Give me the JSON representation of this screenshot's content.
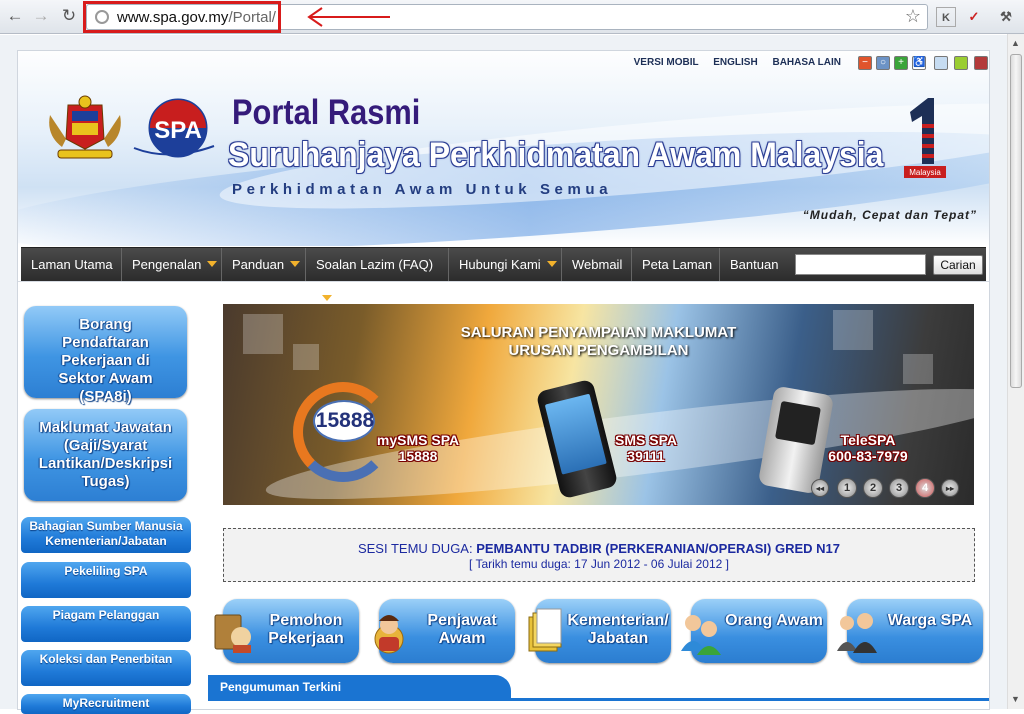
{
  "browser": {
    "url_domain": "www.spa.gov.my",
    "url_path": "/Portal/",
    "back_icon": "back-arrow-icon",
    "forward_icon": "forward-arrow-icon",
    "reload_icon": "reload-icon",
    "bookmark_icon": "star-icon",
    "annotation_color": "#d81b1b"
  },
  "toplinks": {
    "mobile": "VERSI MOBIL",
    "english": "ENGLISH",
    "other": "BAHASA LAIN"
  },
  "header": {
    "title1": "Portal Rasmi",
    "title2": "Suruhanjaya Perkhidmatan Awam Malaysia",
    "subtitle": "Perkhidmatan Awam Untuk Semua",
    "tagline": "“Mudah, Cepat dan Tepat”",
    "logo_spa": "SPA",
    "logo_one_label": "Malaysia"
  },
  "nav": {
    "items": [
      "Laman Utama",
      "Pengenalan",
      "Panduan",
      "Soalan Lazim (FAQ)",
      "Hubungi Kami",
      "Webmail",
      "Peta Laman",
      "Bantuan"
    ],
    "search_button": "Carian",
    "accent": "#f2b22c"
  },
  "sidebar": {
    "big_buttons": [
      "Borang Pendaftaran Pekerjaan di Sektor Awam (SPA8i)",
      "Maklumat Jawatan (Gaji/Syarat Lantikan/Deskripsi Tugas)"
    ],
    "links": [
      "Bahagian Sumber Manusia Kementerian/Jabatan",
      "Pekeliling SPA",
      "Piagam Pelanggan",
      "Koleksi dan Penerbitan",
      "MyRecruitment"
    ]
  },
  "banner": {
    "line1": "SALURAN PENYAMPAIAN MAKLUMAT",
    "line2": "URUSAN PENGAMBILAN",
    "ring_number": "15888",
    "ch1_name": "mySMS SPA",
    "ch1_num": "15888",
    "ch2_name": "SMS SPA",
    "ch2_num": "39111",
    "ch3_name": "TeleSPA",
    "ch3_num": "600-83-7979",
    "pager_prev": "◂◂",
    "pages": [
      "1",
      "2",
      "3",
      "4"
    ],
    "pager_next": "▸▸",
    "active_page": "4"
  },
  "notice": {
    "label": "SESI TEMU DUGA:",
    "title": "PEMBANTU TADBIR (PERKERANIAN/OPERASI) GRED N17",
    "dates": "[ Tarikh temu duga: 17 Jun 2012 - 06 Julai 2012 ]"
  },
  "categories": [
    "Pemohon Pekerjaan",
    "Penjawat Awam",
    "Kementerian/ Jabatan",
    "Orang Awam",
    "Warga SPA"
  ],
  "announcement": {
    "tab": "Pengumuman Terkini"
  }
}
